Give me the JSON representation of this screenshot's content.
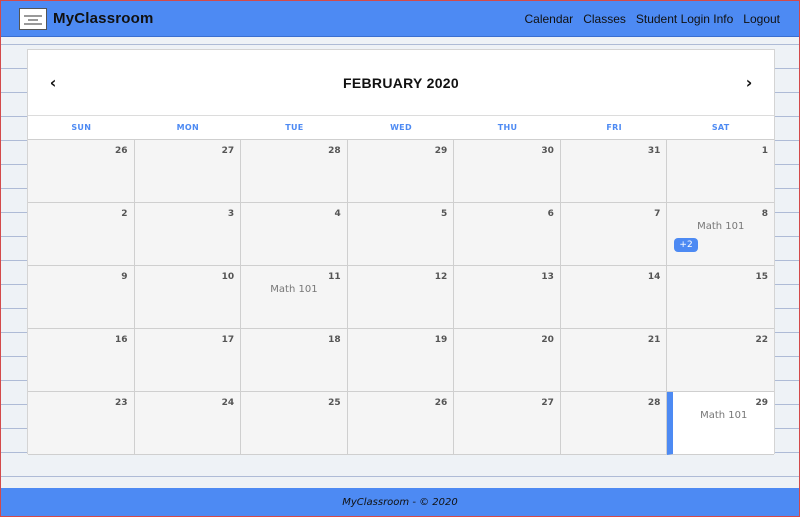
{
  "nav": {
    "brand": "MyClassroom",
    "links": [
      "Calendar",
      "Classes",
      "Student Login Info",
      "Logout"
    ]
  },
  "calendar": {
    "month_title": "FEBRUARY 2020",
    "prev_icon": "chevron-left-icon",
    "next_icon": "chevron-right-icon",
    "weekdays": [
      "SUN",
      "MON",
      "TUE",
      "WED",
      "THU",
      "FRI",
      "SAT"
    ],
    "days": [
      {
        "num": "26"
      },
      {
        "num": "27"
      },
      {
        "num": "28"
      },
      {
        "num": "29"
      },
      {
        "num": "30"
      },
      {
        "num": "31"
      },
      {
        "num": "1"
      },
      {
        "num": "2"
      },
      {
        "num": "3"
      },
      {
        "num": "4"
      },
      {
        "num": "5"
      },
      {
        "num": "6"
      },
      {
        "num": "7"
      },
      {
        "num": "8",
        "event": "Math 101",
        "more": "+2"
      },
      {
        "num": "9"
      },
      {
        "num": "10"
      },
      {
        "num": "11",
        "event": "Math 101"
      },
      {
        "num": "12"
      },
      {
        "num": "13"
      },
      {
        "num": "14"
      },
      {
        "num": "15"
      },
      {
        "num": "16"
      },
      {
        "num": "17"
      },
      {
        "num": "18"
      },
      {
        "num": "19"
      },
      {
        "num": "20"
      },
      {
        "num": "21"
      },
      {
        "num": "22"
      },
      {
        "num": "23"
      },
      {
        "num": "24"
      },
      {
        "num": "25"
      },
      {
        "num": "26"
      },
      {
        "num": "27"
      },
      {
        "num": "28"
      },
      {
        "num": "29",
        "event": "Math 101",
        "today": true
      }
    ]
  },
  "footer": {
    "text": "MyClassroom - © 2020"
  },
  "colors": {
    "accent": "#4d8af3",
    "cell_bg": "#f5f5f5"
  }
}
